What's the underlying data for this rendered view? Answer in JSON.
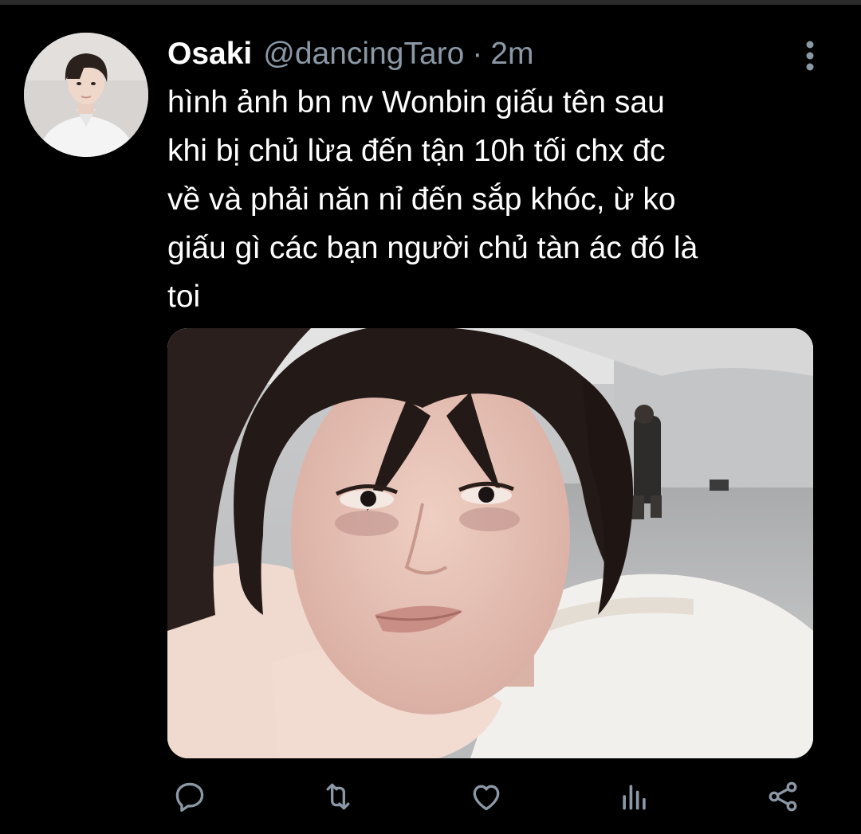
{
  "tweet": {
    "author": {
      "display_name": "Osaki",
      "handle": "@dancingTaro",
      "separator": "·",
      "time": "2m",
      "avatar_icon": "profile-photo"
    },
    "text_lines": [
      "hình ảnh bn nv Wonbin giấu tên sau",
      "khi bị chủ lừa đến tận 10h tối chx đc",
      "về và phải năn nỉ đến sắp khóc, ừ ko",
      "giấu gì các bạn người chủ tàn ác đó là",
      "toi"
    ],
    "media": {
      "kind": "photo",
      "icon": "photo"
    },
    "menu_icon": "more-vertical-icon",
    "actions": [
      {
        "name": "reply",
        "icon": "reply-icon"
      },
      {
        "name": "retweet",
        "icon": "retweet-icon"
      },
      {
        "name": "like",
        "icon": "heart-icon"
      },
      {
        "name": "analytics",
        "icon": "analytics-icon"
      },
      {
        "name": "share",
        "icon": "share-icon"
      }
    ]
  },
  "colors": {
    "background": "#000000",
    "text_primary": "#ffffff",
    "text_secondary": "#8b98a5",
    "icon": "#8b98a5",
    "divider": "#2b2b2b"
  }
}
